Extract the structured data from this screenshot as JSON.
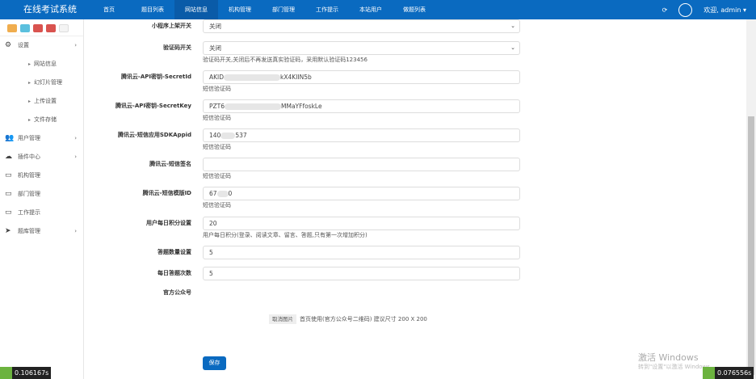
{
  "header": {
    "brand": "在线考试系统",
    "nav": [
      "首页",
      "题目列表",
      "网站信息",
      "机构管理",
      "部门管理",
      "工作提示",
      "本站用户",
      "做题列表"
    ],
    "active": 2,
    "user": "欢迎, admin ▾"
  },
  "sidebar": {
    "items": [
      {
        "label": "设置",
        "icon": "gear-icon",
        "chev": true
      },
      {
        "label": "网站信息",
        "sub": true
      },
      {
        "label": "幻灯片管理",
        "sub": true
      },
      {
        "label": "上传设置",
        "sub": true
      },
      {
        "label": "文件存储",
        "sub": true
      },
      {
        "label": "用户管理",
        "icon": "users-icon",
        "chev": true
      },
      {
        "label": "插件中心",
        "icon": "cloud-icon",
        "chev": true
      },
      {
        "label": "机构管理",
        "icon": "monitor-icon"
      },
      {
        "label": "部门管理",
        "icon": "monitor-icon"
      },
      {
        "label": "工作提示",
        "icon": "monitor-icon"
      },
      {
        "label": "题库管理",
        "icon": "send-icon",
        "chev": true
      }
    ]
  },
  "form": {
    "miniapp": {
      "label": "小程序上架开关",
      "value": "关闭"
    },
    "captcha": {
      "label": "验证码开关",
      "value": "关闭",
      "help": "验证码开关,关闭后不再发送真实验证码，采用默认验证码123456"
    },
    "secretid": {
      "label": "腾讯云-API密钥-SecretId",
      "pre": "AKID",
      "post": "kX4KIIN5b",
      "help": "短信验证码"
    },
    "secretkey": {
      "label": "腾讯云-API密钥-SecretKey",
      "pre": "PZT6",
      "post": "MMaYFfoskLe",
      "help": "短信验证码"
    },
    "appid": {
      "label": "腾讯云-短信应用SDKAppid",
      "pre": "140",
      "post": "537",
      "help": "短信验证码"
    },
    "sign": {
      "label": "腾讯云-短信签名",
      "value": "",
      "help": "短信验证码"
    },
    "template": {
      "label": "腾讯云-短信模版ID",
      "pre": "67",
      "post": "0",
      "help": "短信验证码"
    },
    "points": {
      "label": "用户每日积分设置",
      "value": "20",
      "help": "用户每日积分(登录、阅读文章、留言、答题,只有第一次增加积分)"
    },
    "count": {
      "label": "答题数量设置",
      "value": "5"
    },
    "daily": {
      "label": "每日答题次数",
      "value": "5"
    },
    "wechat": {
      "label": "官方公众号",
      "cancel": "取消图片",
      "help": "首页使用(官方公众号二维码) 建议尺寸 200 X 200"
    },
    "save": "保存"
  },
  "overlay": {
    "timer_left": "0.106167s",
    "timer_right": "0.076556s",
    "wm1": "激活 Windows",
    "wm2": "转到\"设置\"以激活 Windows。"
  }
}
